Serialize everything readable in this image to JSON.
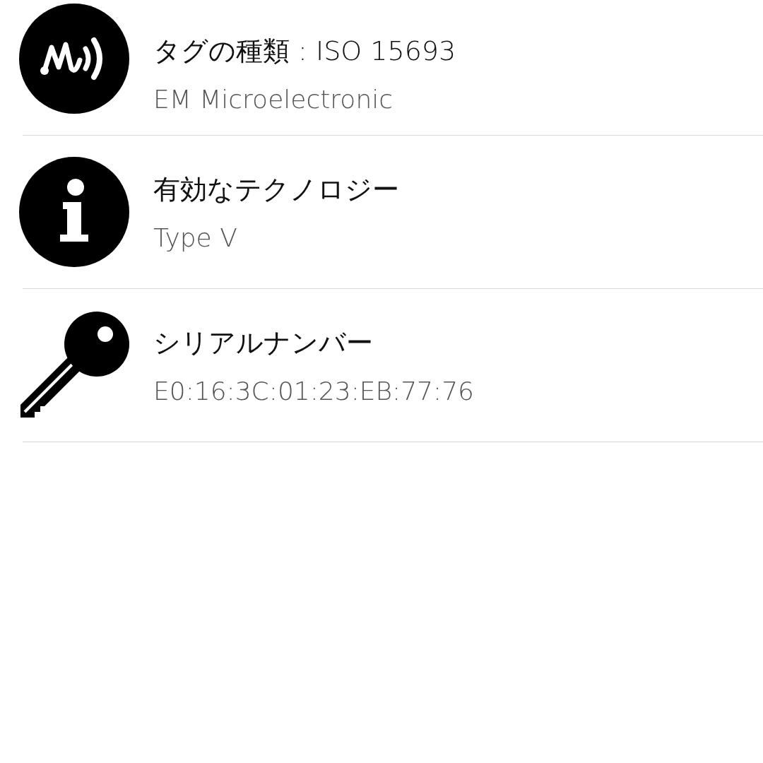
{
  "items": [
    {
      "kind": "tag",
      "title": "タグの種類 : ISO 15693",
      "subtitle": "EM Microelectronic"
    },
    {
      "kind": "info",
      "title": "有効なテクノロジー",
      "subtitle": "Type V"
    },
    {
      "kind": "key",
      "title": "シリアルナンバー",
      "subtitle": "E0:16:3C:01:23:EB:77:76"
    }
  ]
}
